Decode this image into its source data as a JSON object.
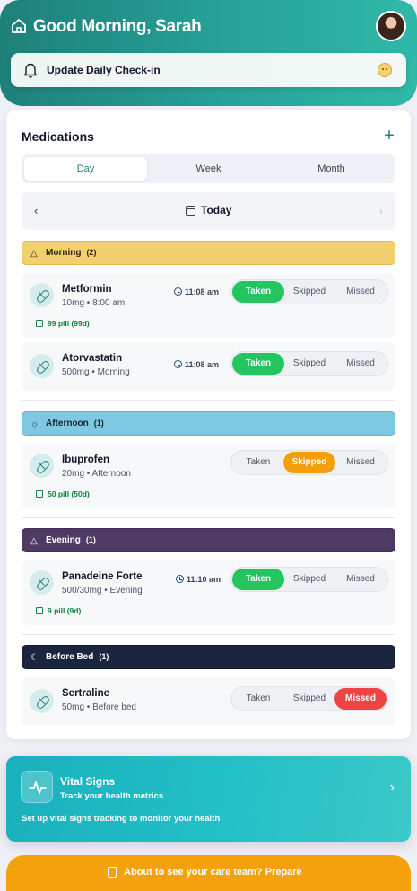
{
  "header": {
    "greeting": "Good Morning, Sarah"
  },
  "checkin": {
    "label": "Update Daily Check-in"
  },
  "medications": {
    "title": "Medications",
    "tabs": [
      "Day",
      "Week",
      "Month"
    ],
    "active_tab": "Day",
    "date_label": "Today",
    "status_labels": {
      "taken": "Taken",
      "skipped": "Skipped",
      "missed": "Missed"
    },
    "sections": [
      {
        "name": "Morning",
        "count": "(2)",
        "color": "#f2d06f",
        "items": [
          {
            "name": "Metformin",
            "dose": "10mg • 8:00 am",
            "time": "11:08 am",
            "supply": "99 pill (99d)",
            "status": "taken"
          },
          {
            "name": "Atorvastatin",
            "dose": "500mg • Morning",
            "time": "11:08 am",
            "status": "taken"
          }
        ]
      },
      {
        "name": "Afternoon",
        "count": "(1)",
        "color": "#7ec8e3",
        "items": [
          {
            "name": "Ibuprofen",
            "dose": "20mg • Afternoon",
            "supply": "50 pill (50d)",
            "status": "skipped"
          }
        ]
      },
      {
        "name": "Evening",
        "count": "(1)",
        "color": "#4f3a63",
        "items": [
          {
            "name": "Panadeine Forte",
            "dose": "500/30mg • Evening",
            "time": "11:10 am",
            "supply": "9 pill (9d)",
            "status": "taken"
          }
        ]
      },
      {
        "name": "Before Bed",
        "count": "(1)",
        "color": "#1c2540",
        "items": [
          {
            "name": "Sertraline",
            "dose": "50mg • Before bed",
            "status": "missed"
          }
        ]
      }
    ]
  },
  "vital_signs": {
    "title": "Vital Signs",
    "subtitle": "Track your health metrics",
    "description": "Set up vital signs tracking to monitor your health"
  },
  "prepare": {
    "label": "About to see your care team? Prepare"
  }
}
